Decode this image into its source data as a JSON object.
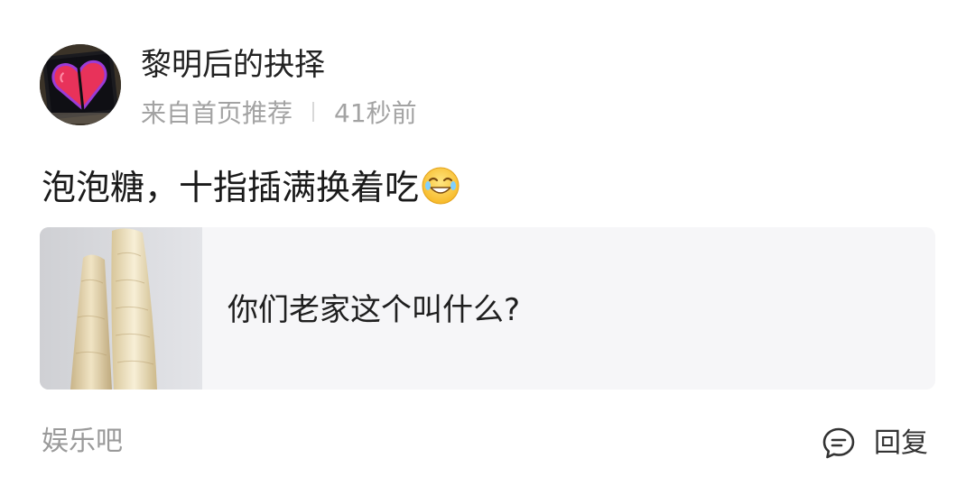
{
  "post": {
    "author": {
      "name": "黎明后的抉择",
      "avatar_icon": "pixel-heart-icon"
    },
    "meta": {
      "source": "来自首页推荐",
      "time": "41秒前"
    },
    "text": "泡泡糖，十指插满换着吃",
    "emoji": "laughing-tears-emoji-icon",
    "quote": {
      "title": "你们老家这个叫什么?",
      "thumbnail": "puffed-snack-photo"
    },
    "footer": {
      "forum": "娱乐吧",
      "reply_label": "回复",
      "reply_icon": "comment-bubble-icon"
    }
  },
  "colors": {
    "background": "#ffffff",
    "card_background": "#f6f6f8",
    "meta_text": "#a3a3a3",
    "heart": "#e8325a"
  }
}
